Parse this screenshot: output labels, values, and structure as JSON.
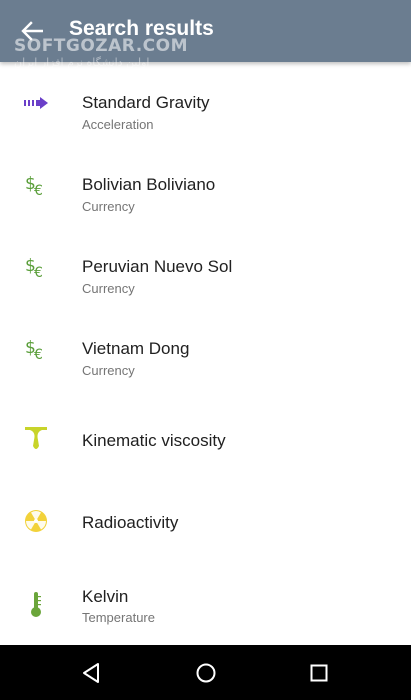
{
  "app_bar": {
    "title": "Search results",
    "watermark": "SOFTGOZAR.COM",
    "watermark_sub": "اولین دانشگاه نرم افزار ایران",
    "back_icon": "arrow-back-icon",
    "color": "#6b7d90"
  },
  "results": [
    {
      "title": "Standard Gravity",
      "subtitle": "Acceleration",
      "icon": "acceleration-arrow-icon"
    },
    {
      "title": "Bolivian Boliviano",
      "subtitle": "Currency",
      "icon": "currency-icon"
    },
    {
      "title": "Peruvian Nuevo Sol",
      "subtitle": "Currency",
      "icon": "currency-icon"
    },
    {
      "title": "Vietnam Dong",
      "subtitle": "Currency",
      "icon": "currency-icon"
    },
    {
      "title": "Kinematic viscosity",
      "subtitle": "",
      "icon": "viscosity-drop-icon"
    },
    {
      "title": "Radioactivity",
      "subtitle": "",
      "icon": "radioactivity-icon"
    },
    {
      "title": "Kelvin",
      "subtitle": "Temperature",
      "icon": "thermometer-icon"
    }
  ],
  "nav_bar": {
    "back": "nav-back-icon",
    "home": "nav-home-icon",
    "recents": "nav-recents-icon"
  },
  "colors": {
    "accent_purple": "#6a3fc8",
    "currency_green": "#5a9e3a",
    "viscosity_yellow": "#c8d42a",
    "radio_yellow": "#f2d23a",
    "thermo_green": "#6aa53a"
  }
}
